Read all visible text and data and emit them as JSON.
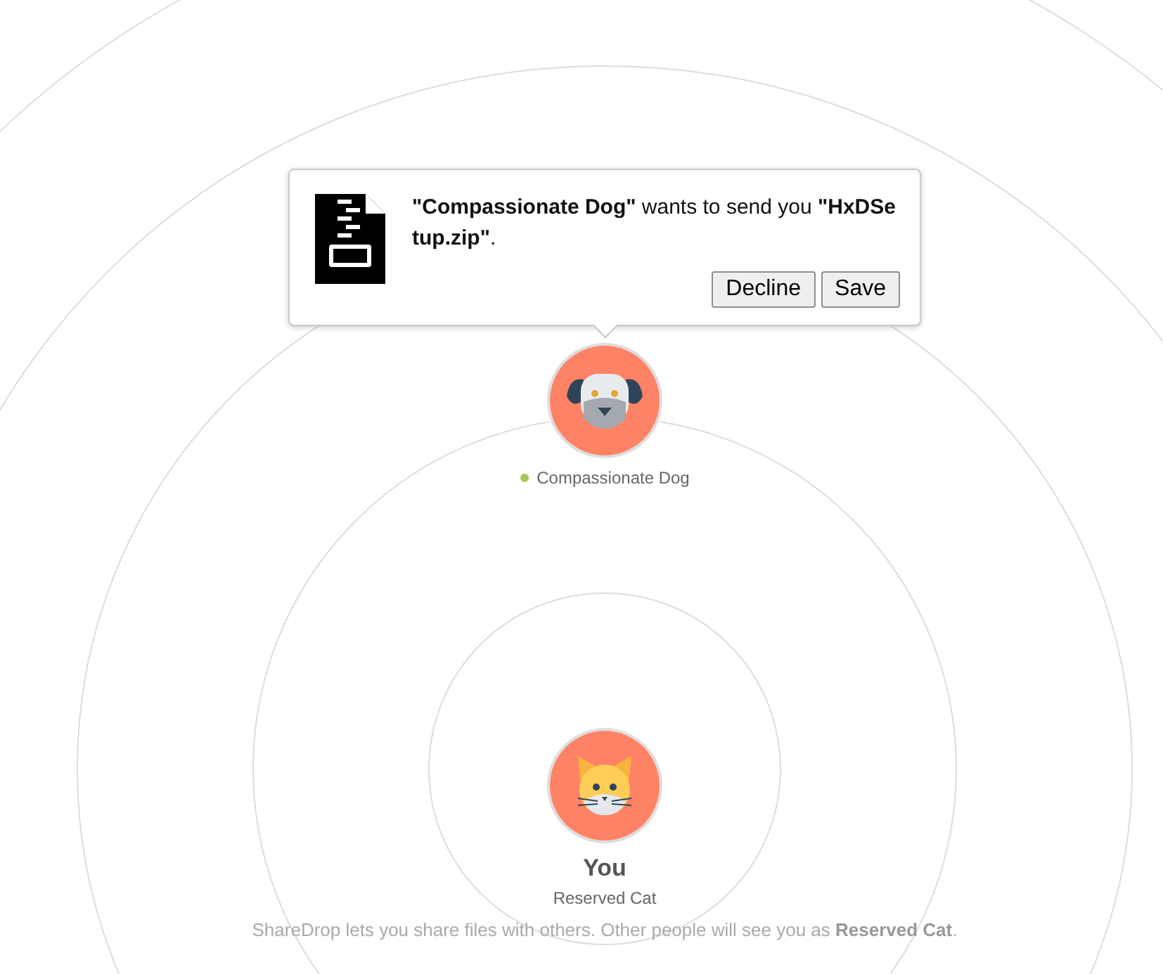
{
  "transfer_prompt": {
    "message": "**\"Compassionate Dog\"** wants to send you **\"HxDSetup.zip\"**.",
    "buttons": [
      {
        "label": "Decline"
      },
      {
        "label": "Save"
      }
    ]
  },
  "peer": {
    "name": "Compassionate Dog",
    "online": true
  },
  "me": {
    "title": "You",
    "name": "Reserved Cat"
  },
  "footer": "ShareDrop lets you share files with others. Other people will see you as **Reserved Cat**."
}
